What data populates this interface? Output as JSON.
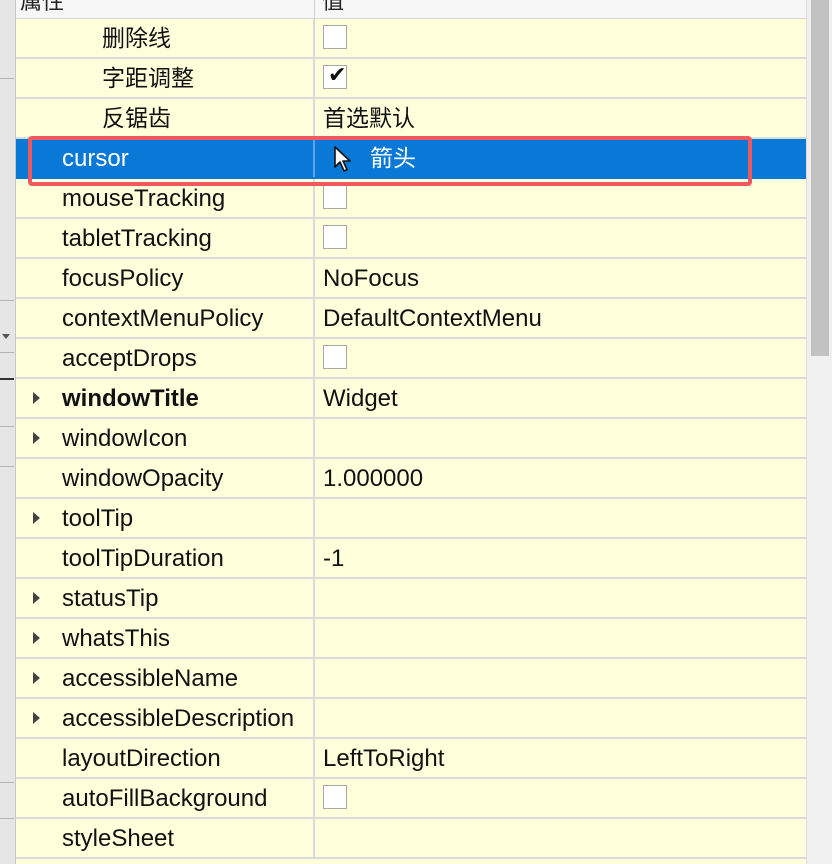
{
  "header": {
    "property_col": "属性",
    "value_col": "值"
  },
  "rows": [
    {
      "name": "删除线",
      "type": "checkbox",
      "checked": false
    },
    {
      "name": "字距调整",
      "type": "checkbox",
      "checked": true,
      "tick": "✔"
    },
    {
      "name": "反锯齿",
      "type": "text",
      "value": "首选默认"
    },
    {
      "name": "cursor",
      "type": "cursor",
      "value": "箭头",
      "selected": true
    },
    {
      "name": "mouseTracking",
      "type": "checkbox",
      "checked": false
    },
    {
      "name": "tabletTracking",
      "type": "checkbox",
      "checked": false
    },
    {
      "name": "focusPolicy",
      "type": "text",
      "value": "NoFocus"
    },
    {
      "name": "contextMenuPolicy",
      "type": "text",
      "value": "DefaultContextMenu"
    },
    {
      "name": "acceptDrops",
      "type": "checkbox",
      "checked": false
    },
    {
      "name": "windowTitle",
      "type": "text",
      "value": "Widget",
      "bold": true,
      "expandable": true
    },
    {
      "name": "windowIcon",
      "type": "text",
      "value": "",
      "expandable": true
    },
    {
      "name": "windowOpacity",
      "type": "text",
      "value": "1.000000"
    },
    {
      "name": "toolTip",
      "type": "text",
      "value": "",
      "expandable": true
    },
    {
      "name": "toolTipDuration",
      "type": "text",
      "value": "-1"
    },
    {
      "name": "statusTip",
      "type": "text",
      "value": "",
      "expandable": true
    },
    {
      "name": "whatsThis",
      "type": "text",
      "value": "",
      "expandable": true
    },
    {
      "name": "accessibleName",
      "type": "text",
      "value": "",
      "expandable": true
    },
    {
      "name": "accessibleDescription",
      "type": "text",
      "value": "",
      "expandable": true
    },
    {
      "name": "layoutDirection",
      "type": "text",
      "value": "LeftToRight"
    },
    {
      "name": "autoFillBackground",
      "type": "checkbox",
      "checked": false
    },
    {
      "name": "styleSheet",
      "type": "text",
      "value": ""
    }
  ],
  "colors": {
    "row_background": "#ffffdc",
    "selection": "#0a78d7",
    "highlight_border": "#f0585f"
  },
  "icons": {
    "cursor_value": "arrow-cursor-icon",
    "expander": "expand-arrow-icon"
  }
}
